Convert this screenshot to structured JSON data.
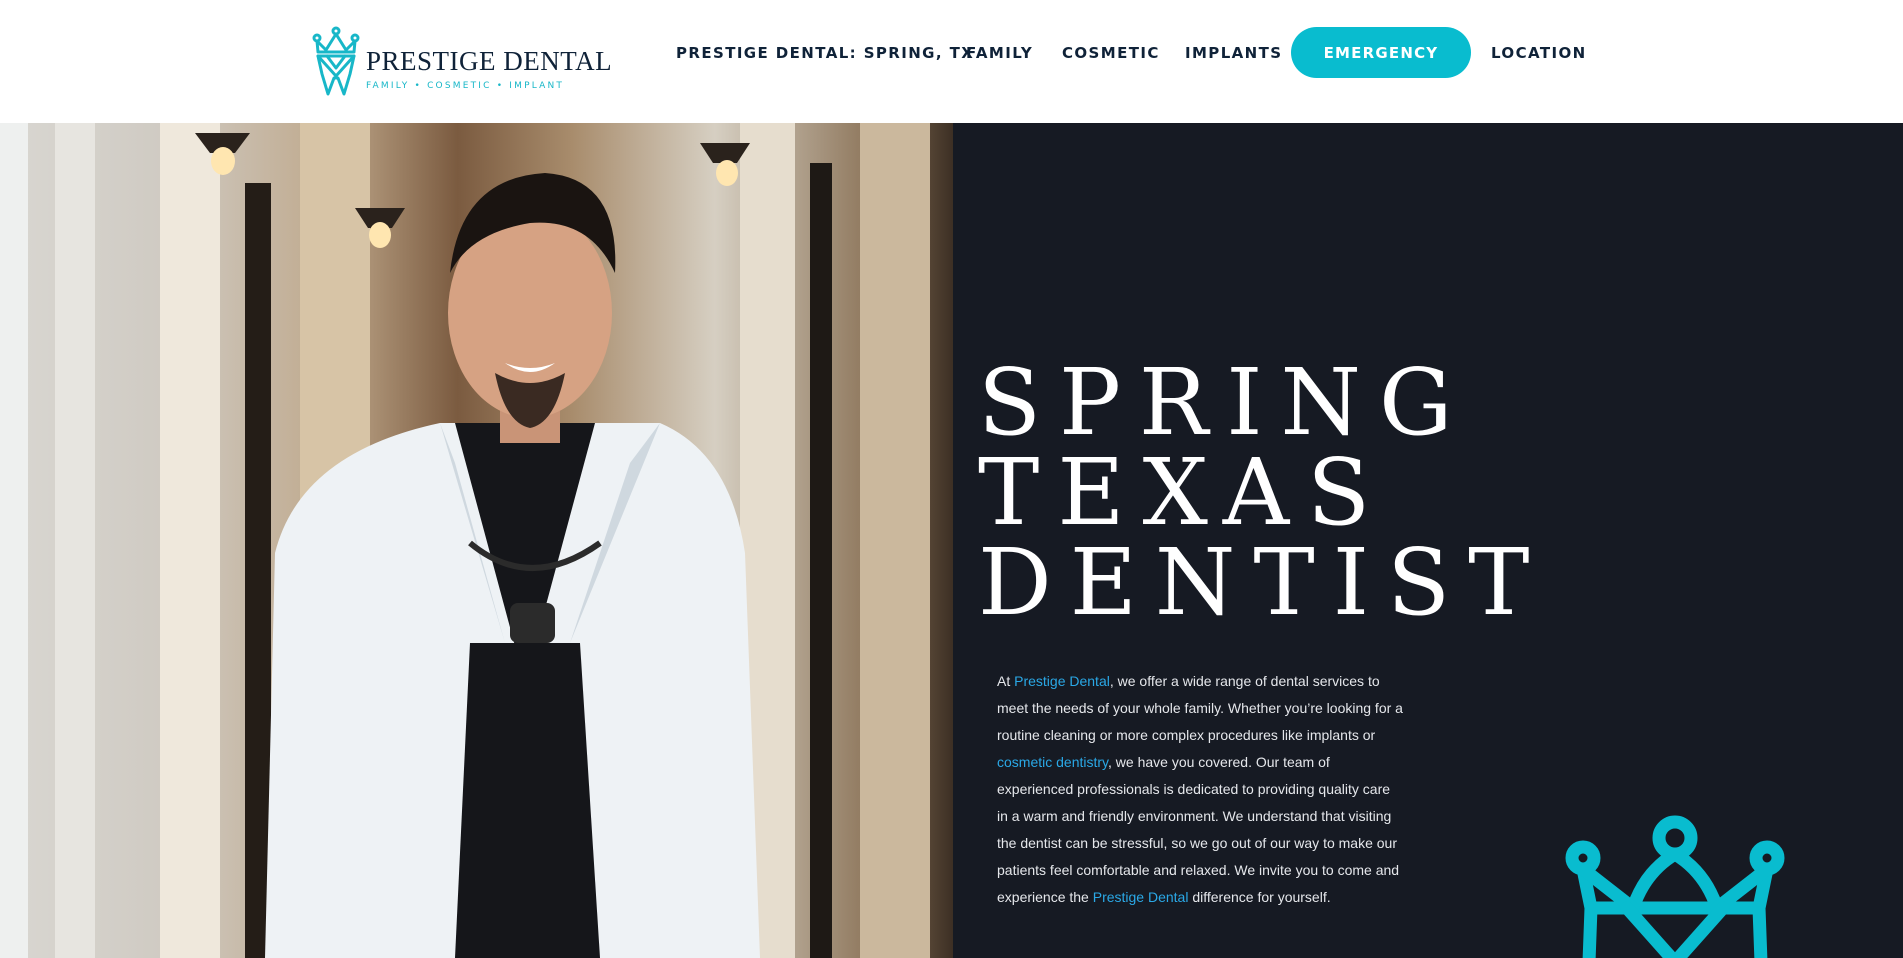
{
  "brand": {
    "name": "PRESTIGE DENTAL",
    "tagline": "FAMILY • COSMETIC • IMPLANT",
    "accent": "#09bccf",
    "navy": "#0f2238",
    "dark_bg": "#161a23"
  },
  "nav": {
    "items": [
      {
        "label": "PRESTIGE DENTAL: SPRING, TX"
      },
      {
        "label": "FAMILY"
      },
      {
        "label": "COSMETIC"
      },
      {
        "label": "IMPLANTS"
      },
      {
        "label": "EMERGENCY"
      },
      {
        "label": "LOCATION"
      }
    ]
  },
  "hero": {
    "headline_lines": [
      "SPRING",
      "TEXAS",
      "DENTIST"
    ],
    "intro": {
      "p1": "At ",
      "link1": "Prestige Dental",
      "p2": ", we offer a wide range of dental services to meet the needs of your whole family. Whether you’re looking for a routine cleaning or more complex procedures like implants or ",
      "link2": "cosmetic dentistry",
      "p3": ", we have you covered. Our team of experienced professionals is dedicated to providing quality care in a warm and friendly environment. We understand that visiting the dentist can be stressful, so we go out of our way to make our patients feel comfortable and relaxed. We invite you to come and experience the ",
      "link3": "Prestige Dental",
      "p4": " difference for yourself."
    },
    "link_color": "#2aa8e6"
  },
  "icons": {
    "logo": "crown-tooth-logo-icon",
    "decor": "crown-icon"
  }
}
